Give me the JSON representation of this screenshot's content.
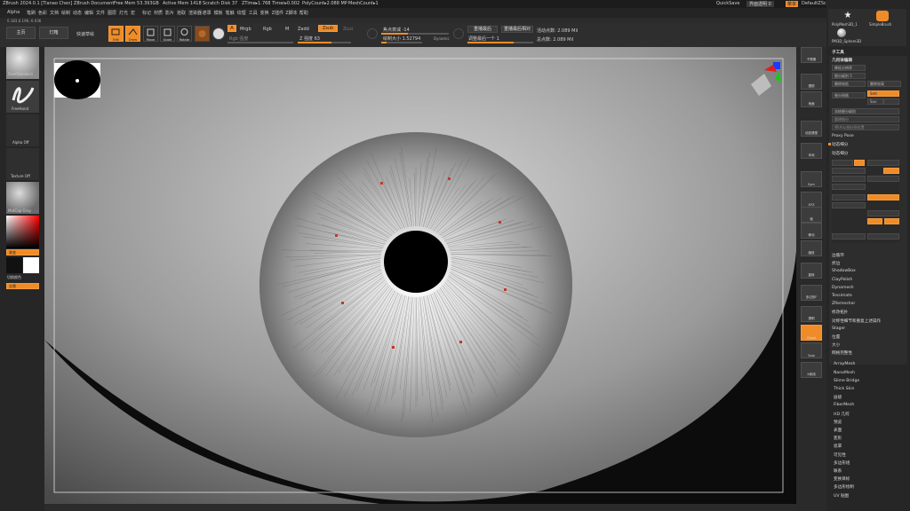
{
  "titlebar": {
    "app_title": "ZBrush 2024.0.1 [Tianao Chen]  ZBrush Document",
    "free_mem": "Free Mem 53.393GB",
    "active_mem": "Active Mem 1418",
    "scratch_disk": "Scratch Disk 37",
    "ztime": "ZTime▸1.768 Timer▸0.002",
    "polycount": "PolyCount▸2.088 MP",
    "meshcount": "MeshCount▸1",
    "quicksave": "QuickSave",
    "transparency": "界面透明 0",
    "menus_btn": "菜单",
    "default_zscript": "DefaultZScript"
  },
  "menubar": {
    "items": [
      "Alpha",
      "笔刷",
      "色彩",
      "文档",
      "绘制",
      "动态",
      "编辑",
      "文件",
      "图层",
      "灯光",
      "宏",
      "标记",
      "材质",
      "影片",
      "拾取",
      "渲染器",
      "遮罩",
      "模板",
      "笔触",
      "纹理",
      "工具",
      "变换",
      "Z插件",
      "Z脚本",
      "帮助"
    ]
  },
  "coords": "0.183,0.196,-0.036",
  "toolbar": {
    "home_label": "主页",
    "lightbox_label": "灯箱",
    "quicksketch_label": "快速草绘",
    "gizmo_label": "硬笔布尔渲染",
    "edit_label": "Edit",
    "draw_label": "Draw",
    "move_label": "Move",
    "scale_label": "Scale",
    "rotate_label": "Rotate",
    "a_label": "A",
    "mrgb_label": "Mrgb",
    "rgb_label": "Rgb",
    "m_label": "M",
    "zadd_label": "Zadd",
    "zsub_label": "Zsub",
    "zcut_label": "Zcut",
    "rgb_intensity": "Rgb 强度",
    "z_intensity": "Z 强度 63",
    "focal_shift": "焦点衰减 -14",
    "draw_size": "绘制大小 1.52794",
    "dynamic": "Dynamic",
    "active_points": "活动点数: 2.089 Mil",
    "total_points": "总点数: 2.089 Mil",
    "replay_last": "重播最后",
    "replay_last_rel": "重播最后相对",
    "adjust_last": "调整最后一个 1"
  },
  "leftpanel": {
    "brush_label": "DamStandard",
    "stroke_label": "FreeHand",
    "alpha_label": "Alpha Off",
    "texture_label": "Texture Off",
    "material_label": "MatCap Gray",
    "gradient_label": "渐变",
    "switch_color": "切换颜色",
    "alternate_label": "交替"
  },
  "viewport": {
    "iris_markers": 9
  },
  "rightshelf": {
    "labels": [
      "子像素",
      "透视",
      "地面",
      "动态透视",
      "本地",
      "Sym",
      "XYZ",
      "帧",
      "移动",
      "缩放",
      "旋转",
      "多边形F",
      "透明",
      "Ghost",
      "Solo",
      "X射线"
    ]
  },
  "rightpanel": {
    "tool_thumbs": [
      "PolyMesh3D_1",
      "SimpleBrush",
      "PM3D_Sphere3D"
    ],
    "subtool_header": "子工具",
    "geometry_header": "几何体编辑",
    "items": [
      "降低分辨率",
      "细分级别 5",
      "删除较低",
      "删除较高",
      "细分网格",
      "冻结细分级别",
      "重建细分",
      "将UV从细分到位置",
      "Proxy Pose",
      "动态细分",
      "动态细分",
      "边循环",
      "折边",
      "ShadowBox",
      "ClayPolish",
      "Dynamesh",
      "Tessimate",
      "ZRemesher",
      "修改拓扑",
      "对称性细节和重复上述操作",
      "Stager",
      "位置",
      "大小",
      "网格完整性",
      "ArrayMesh",
      "NanoMesh",
      "Slime Bridge",
      "Thick Skin",
      "层级",
      "FiberMesh",
      "HD 几何",
      "预览",
      "表面",
      "变形",
      "遮罩",
      "可见性",
      "多边形组",
      "联系",
      "变换目标",
      "多边形绘制",
      "UV 贴图"
    ],
    "dynamic_sub_label": "动态细分",
    "smt_label": "Smt",
    "suv_label": "Suv",
    "reluv_label": "ReUV"
  },
  "colors": {
    "accent": "#f08c28",
    "background": "#2b2b2b",
    "panel": "#262626"
  }
}
